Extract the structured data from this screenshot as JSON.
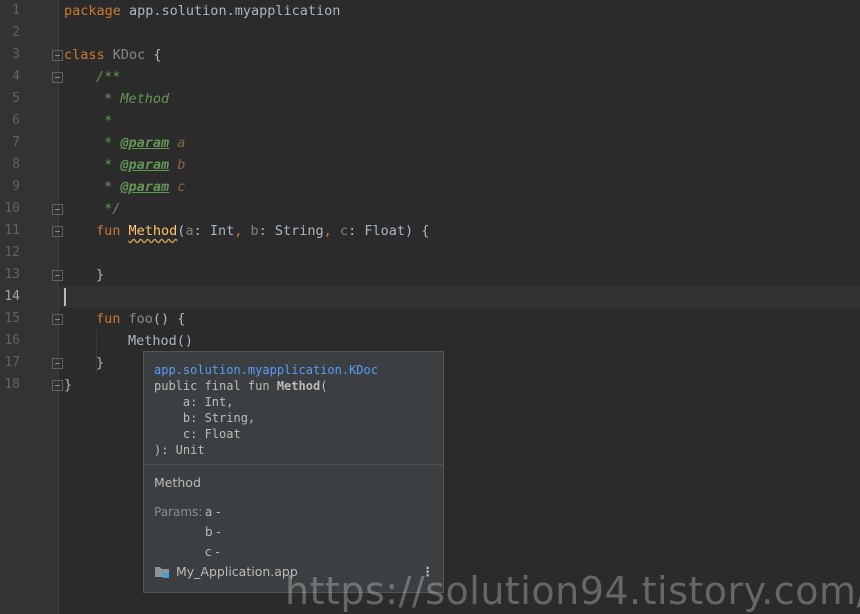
{
  "editor": {
    "line_numbers": [
      "1",
      "2",
      "3",
      "4",
      "5",
      "6",
      "7",
      "8",
      "9",
      "10",
      "11",
      "12",
      "13",
      "14",
      "15",
      "16",
      "17",
      "18"
    ],
    "current_line": "14",
    "lines": {
      "l1_kw": "package",
      "l1_pkg": " app.solution.myapplication",
      "l3_kw": "class",
      "l3_name": " KDoc ",
      "l3_brace": "{",
      "l4": "/**",
      "l5": " * Method",
      "l6": " *",
      "l7_star": " * ",
      "l7_tag": "@param",
      "l7_name": " a",
      "l8_star": " * ",
      "l8_tag": "@param",
      "l8_name": " b",
      "l9_star": " * ",
      "l9_tag": "@param",
      "l9_name": " c",
      "l10": " */",
      "l11_kw": "fun ",
      "l11_fn": "Method",
      "l11_p1": "(",
      "l11_a": "a",
      "l11_t1": ": Int",
      "l11_c1": ", ",
      "l11_b": "b",
      "l11_t2": ": String",
      "l11_c2": ", ",
      "l11_c": "c",
      "l11_t3": ": Float) {",
      "l13": "}",
      "l15_kw": "fun ",
      "l15_fn": "foo",
      "l15_rest": "() {",
      "l16": "Method()",
      "l17": "}",
      "l18": "}"
    }
  },
  "popup": {
    "fq_name": "app.solution.myapplication.KDoc",
    "sig_prefix": "public final fun ",
    "sig_name": "Method",
    "sig_open": "(",
    "sig_a": "    a: Int,",
    "sig_b": "    b: String,",
    "sig_c": "    c: Float",
    "sig_close": "): Unit",
    "description": "Method",
    "params_label": "Params:",
    "params": [
      "a -",
      "b -",
      "c -"
    ],
    "module": "My_Application.app",
    "more_icon": "⋮"
  },
  "watermark": "https://solution94.tistory.com/"
}
